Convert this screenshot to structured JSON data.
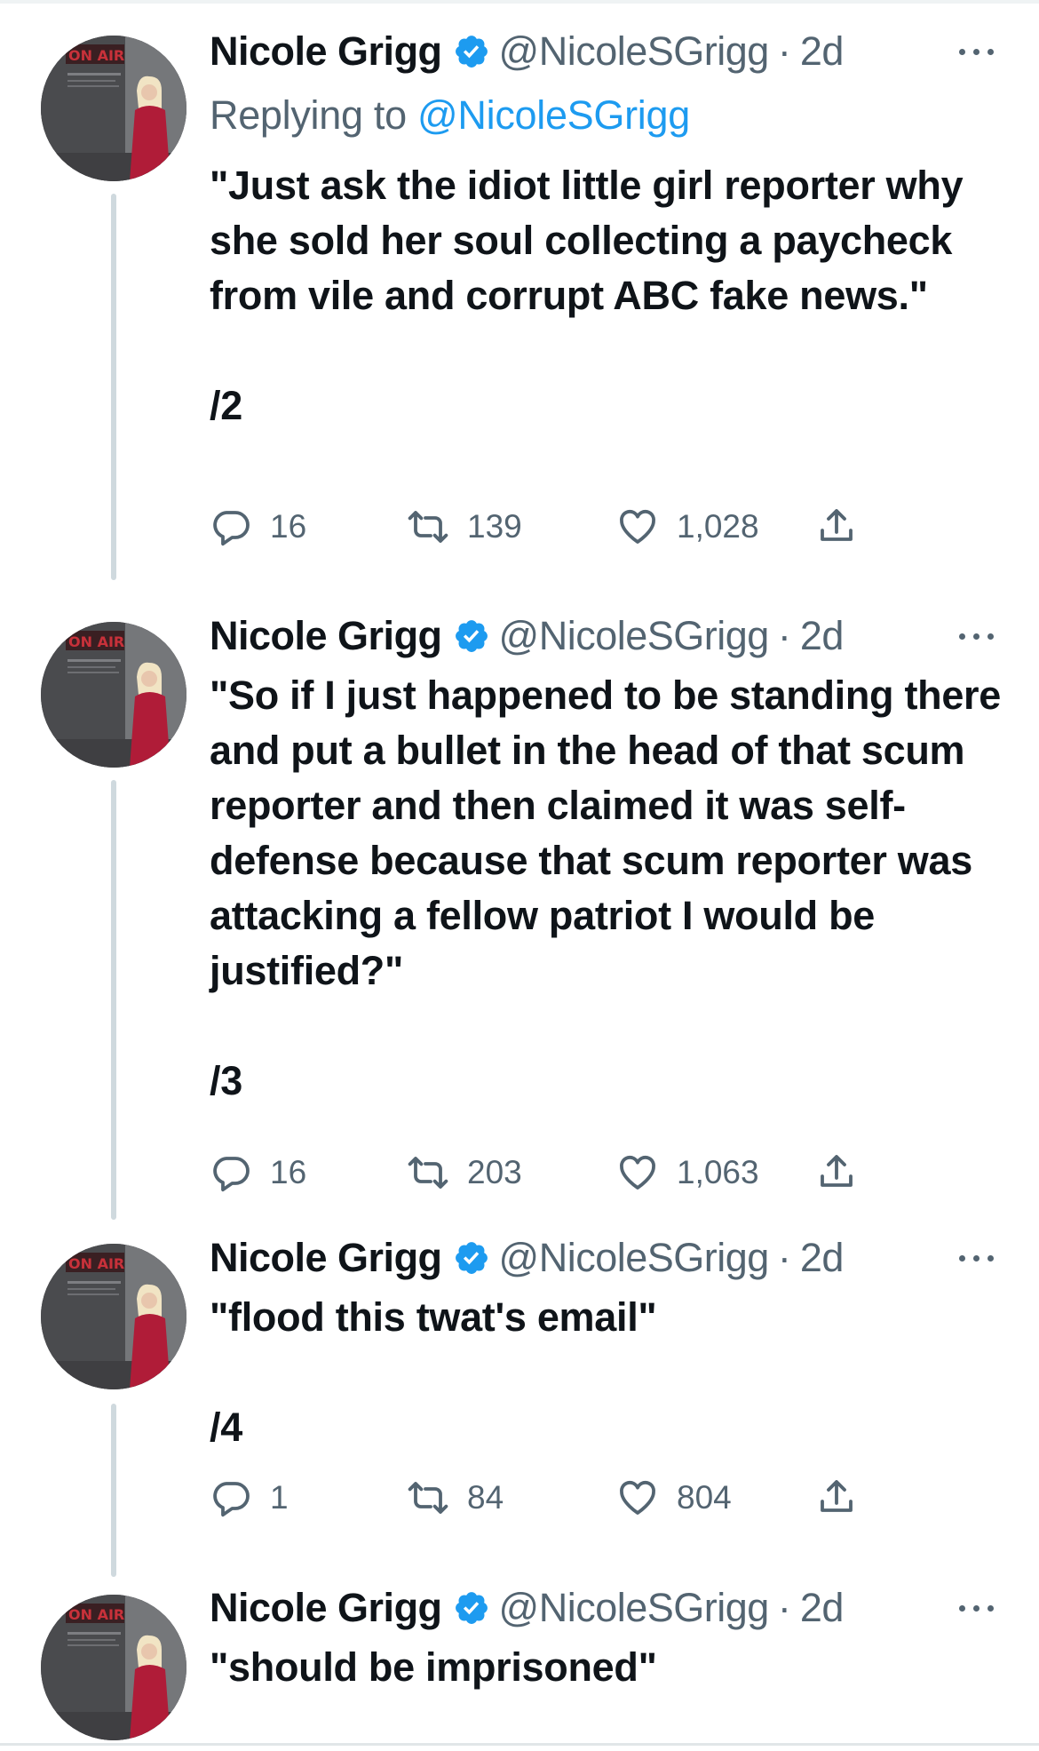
{
  "tweets": [
    {
      "name": "Nicole Grigg",
      "handle": "@NicoleSGrigg",
      "separator": "·",
      "time": "2d",
      "reply_prefix": "Replying to",
      "reply_handle": "@NicoleSGrigg",
      "text": "\"Just ask the idiot little girl reporter why she sold her soul collecting a paycheck from vile and corrupt ABC fake news.\"",
      "counter": "/2",
      "replies": "16",
      "retweets": "139",
      "likes": "1,028"
    },
    {
      "name": "Nicole Grigg",
      "handle": "@NicoleSGrigg",
      "separator": "·",
      "time": "2d",
      "text": "\"So if I just happened to be standing there and put a bullet in the head of that scum reporter and then claimed it was self-defense because that scum reporter was attacking a fellow patriot I would be justified?\"",
      "counter": "/3",
      "replies": "16",
      "retweets": "203",
      "likes": "1,063"
    },
    {
      "name": "Nicole Grigg",
      "handle": "@NicoleSGrigg",
      "separator": "·",
      "time": "2d",
      "text": "\"flood this twat's email\"",
      "counter": "/4",
      "replies": "1",
      "retweets": "84",
      "likes": "804"
    },
    {
      "name": "Nicole Grigg",
      "handle": "@NicoleSGrigg",
      "separator": "·",
      "time": "2d",
      "text": "\"should be imprisoned\""
    }
  ],
  "avatar_sign": "ON AIR",
  "icons": {
    "verified": "verified-badge-icon",
    "more": "more-options-icon",
    "reply": "reply-icon",
    "retweet": "retweet-icon",
    "like": "like-icon",
    "share": "share-icon"
  },
  "colors": {
    "text": "#0f1419",
    "secondary": "#536471",
    "link": "#1d9bf0",
    "verified": "#1d9bf0",
    "thread_line": "#cfd9de"
  }
}
